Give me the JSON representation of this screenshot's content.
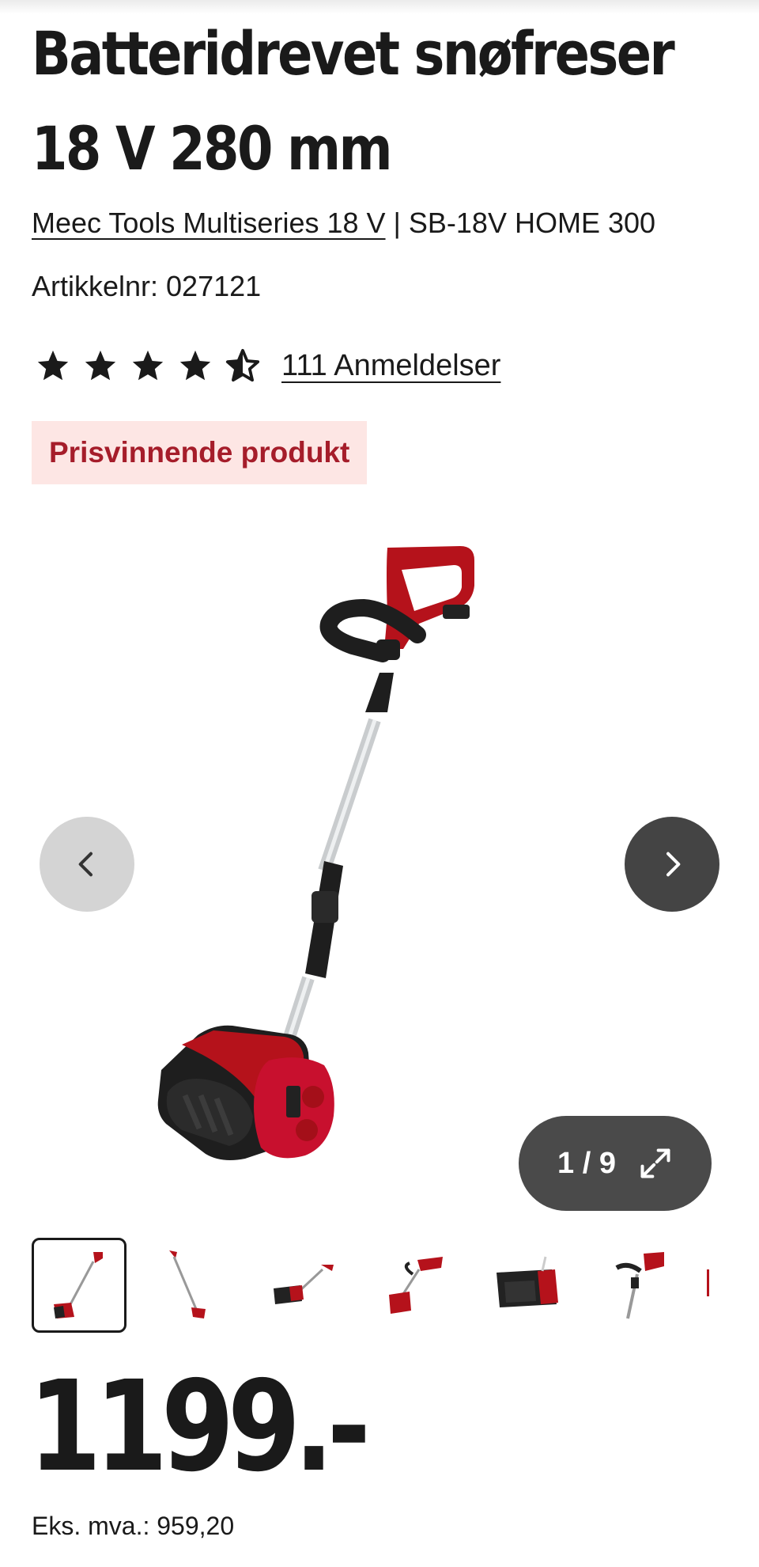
{
  "product": {
    "title": "Batteridrevet snøfreser 18 V 280 mm",
    "series_link": "Meec Tools Multiseries 18 V",
    "separator": " | ",
    "model": "SB-18V HOME 300",
    "article_label": "Artikkelnr: 027121",
    "rating": 4.5,
    "reviews_label": "111 Anmeldelser",
    "badge": "Prisvinnende produkt"
  },
  "gallery": {
    "current_index": "1",
    "separator": "/",
    "total": "9",
    "prev_icon": "chevron-left-icon",
    "next_icon": "chevron-right-icon",
    "expand_icon": "expand-arrows-icon",
    "thumbnail_count_visible": 6
  },
  "pricing": {
    "price": "1199.-",
    "ex_vat": "Eks. mva.: 959,20"
  },
  "colors": {
    "brand_red": "#c8102e",
    "badge_bg": "#fde6e4",
    "badge_text": "#a51d2a",
    "dark_button": "#444444"
  }
}
